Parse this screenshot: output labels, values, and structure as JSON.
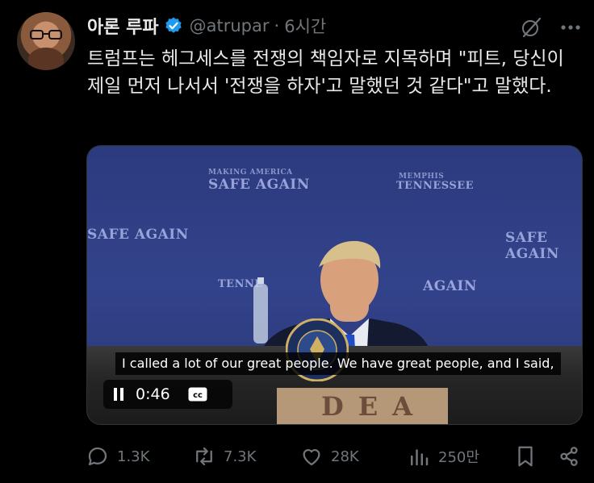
{
  "author": {
    "name": "아론 루파",
    "handle": "@atrupar",
    "separator": "·",
    "time": "6시간"
  },
  "tweet": {
    "text": "트럼프는 헤그세스를 전쟁의 책임자로 지목하며 \"피트, 당신이 제일 먼저 나서서 '전쟁을 하자'고 말했던 것 같다\"고 말했다."
  },
  "media": {
    "subtitle": "I called a lot of our great people. We have great people, and I said,",
    "timestamp": "0:46",
    "cc_label": "cc",
    "banners": {
      "safe_again": "SAFE AGAIN",
      "making_america": "MAKING AMERICA",
      "memphis": "MEMPHIS",
      "tennessee": "TENNESSEE",
      "tenne_partial": "TENNE",
      "again_partial": "AGAIN",
      "box_text": "DEA"
    }
  },
  "actions": {
    "replies": "1.3K",
    "reposts": "7.3K",
    "likes": "28K",
    "views": "250만"
  },
  "icons": {
    "verified": "verified-badge-icon",
    "grok": "grok-icon",
    "more": "more-icon",
    "pause": "pause-icon",
    "cc": "cc-icon",
    "reply": "reply-icon",
    "repost": "repost-icon",
    "like": "like-icon",
    "views": "views-icon",
    "bookmark": "bookmark-icon",
    "share": "share-icon"
  },
  "colors": {
    "background": "#000000",
    "text_primary": "#e7e9ea",
    "text_secondary": "#71767b",
    "verified_blue": "#1d9bf0"
  }
}
